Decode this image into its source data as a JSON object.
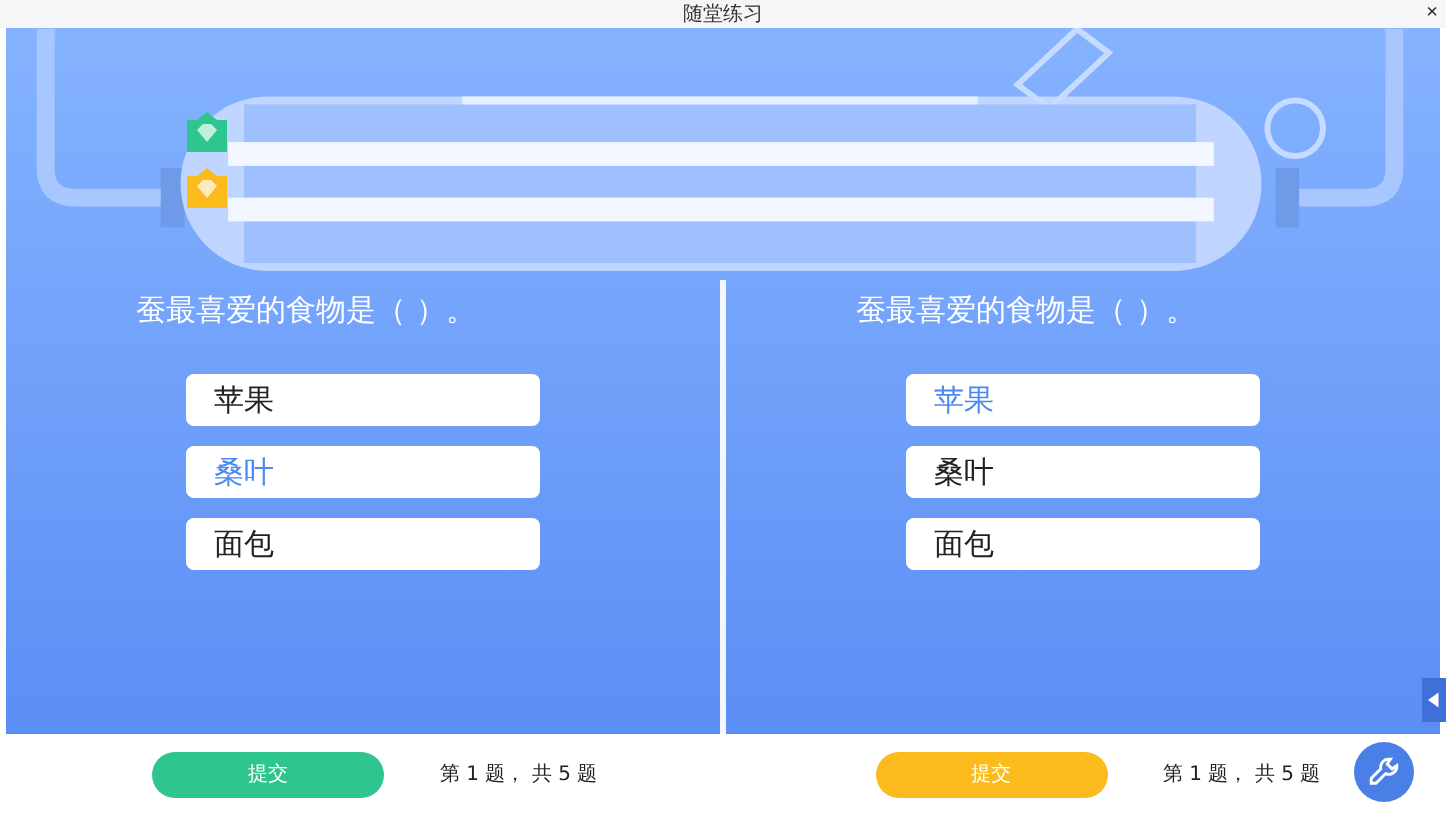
{
  "window": {
    "title": "随堂练习",
    "close": "×"
  },
  "tube": {
    "markers": [
      {
        "color": "#2ec58f"
      },
      {
        "color": "#fbbb1c"
      }
    ]
  },
  "players": [
    {
      "color": "#2ec58f",
      "question": "蚕最喜爱的食物是（ ）。",
      "options": [
        {
          "label": "苹果",
          "selected": false
        },
        {
          "label": "桑叶",
          "selected": true
        },
        {
          "label": "面包",
          "selected": false
        }
      ],
      "submit": "提交",
      "progress": "第 1 题， 共 5 题"
    },
    {
      "color": "#fbbb1c",
      "question": "蚕最喜爱的食物是（ ）。",
      "options": [
        {
          "label": "苹果",
          "selected": true
        },
        {
          "label": "桑叶",
          "selected": false
        },
        {
          "label": "面包",
          "selected": false
        }
      ],
      "submit": "提交",
      "progress": "第 1 题， 共 5 题"
    }
  ]
}
